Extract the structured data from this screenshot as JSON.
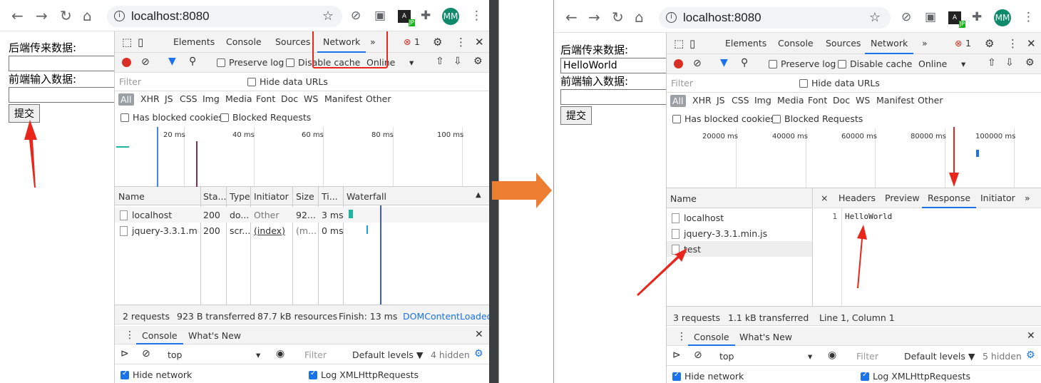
{
  "browser": {
    "url": "localhost:8080",
    "avatar_initials": "MM",
    "jp_badge": "JP"
  },
  "page": {
    "backend_label": "后端传来数据:",
    "frontend_label": "前端输入数据:",
    "submit_label": "提交",
    "left_backend_value": "",
    "right_backend_value": "HelloWorld"
  },
  "devtools": {
    "tabs": [
      "Elements",
      "Console",
      "Sources",
      "Network",
      "»"
    ],
    "error_count": "1",
    "preserve_log": "Preserve log",
    "disable_cache": "Disable cache",
    "online": "Online",
    "filter_placeholder": "Filter",
    "hide_data_urls": "Hide data URLs",
    "types": [
      "All",
      "XHR",
      "JS",
      "CSS",
      "Img",
      "Media",
      "Font",
      "Doc",
      "WS",
      "Manifest",
      "Other"
    ],
    "has_blocked_cookies": "Has blocked cookies",
    "blocked_requests": "Blocked Requests"
  },
  "left_net": {
    "overview_ticks": [
      "20 ms",
      "40 ms",
      "60 ms",
      "80 ms",
      "100 ms"
    ],
    "headers": [
      "Name",
      "Sta...",
      "Type",
      "Initiator",
      "Size",
      "Ti...",
      "Waterfall"
    ],
    "rows": [
      {
        "name": "localhost",
        "status": "200",
        "type": "do...",
        "initiator": "Other",
        "size": "92...",
        "time": "3 ms"
      },
      {
        "name": "jquery-3.3.1.mi...",
        "status": "200",
        "type": "scr...",
        "initiator": "(index)",
        "size": "(m...",
        "time": "0 ms"
      }
    ],
    "status_bar": [
      "2 requests",
      "923 B transferred",
      "87.7 kB resources",
      "Finish: 13 ms",
      "DOMContentLoaded:"
    ]
  },
  "right_net": {
    "overview_ticks": [
      "20000 ms",
      "40000 ms",
      "60000 ms",
      "80000 ms",
      "100000 ms"
    ],
    "name_header": "Name",
    "rows": [
      "localhost",
      "jquery-3.3.1.min.js",
      "test"
    ],
    "detail_tabs": [
      "Headers",
      "Preview",
      "Response",
      "Initiator",
      "»"
    ],
    "close_glyph": "×",
    "response_line_no": "1",
    "response_text": "HelloWorld",
    "status_bar": [
      "3 requests",
      "1.1 kB transferred"
    ],
    "cursor_pos": "Line 1, Column 1"
  },
  "drawer": {
    "tabs": [
      "Console",
      "What's New"
    ],
    "context": "top",
    "filter_placeholder": "Filter",
    "levels": "Default levels ▼",
    "left_hidden": "4 hidden",
    "right_hidden": "5 hidden",
    "hide_network": "Hide network",
    "log_xhr": "Log XMLHttpRequests"
  },
  "colors": {
    "accent": "#1a73e8",
    "red_annotation": "#e8261c",
    "orange_arrow": "#ed7d31"
  }
}
